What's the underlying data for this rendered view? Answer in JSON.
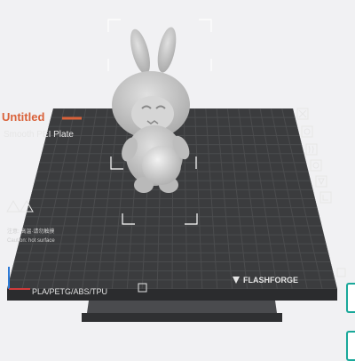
{
  "plate": {
    "project_title": "Untitled",
    "plate_type": "Smooth PEI Plate",
    "materials": "PLA/PETG/ABS/TPU",
    "brand": "FLASHFORGE",
    "warning_lines": [
      "注意: 高温·请勿触摸",
      "Caution: hot surface"
    ]
  },
  "model": {
    "name": "figurine-model"
  },
  "colors": {
    "background": "#f1f1f3",
    "plate_surface": "#3b3c3e",
    "plate_grid": "#4b4c4e",
    "plate_base": "#2b2c2e",
    "accent_title": "#d9623a",
    "plate_text": "#e6e6e6",
    "model": "#c9c9c9",
    "side_panel_accent": "#1aa89a",
    "axis_x": "#d13b3b",
    "axis_y": "#2f7bd6"
  },
  "icons": [
    "fan-icon",
    "gear-icon",
    "heat-icon",
    "filament-icon",
    "nozzle-icon",
    "extruder-icon"
  ]
}
